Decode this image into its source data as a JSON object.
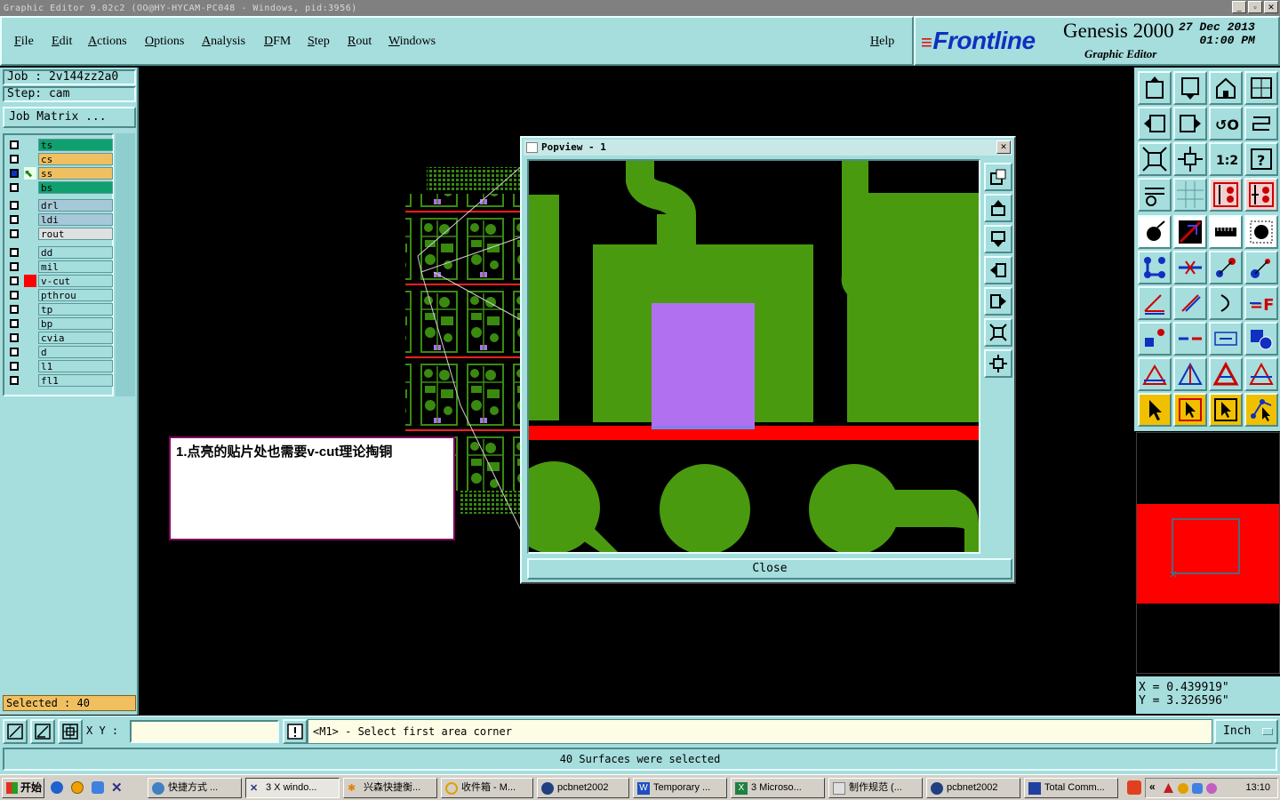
{
  "window": {
    "title": "Graphic Editor 9.02c2  (OO@HY-HYCAM-PC048 - Windows, pid:3956)"
  },
  "menu": {
    "items": [
      "File",
      "Edit",
      "Actions",
      "Options",
      "Analysis",
      "DFM",
      "Step",
      "Rout",
      "Windows"
    ],
    "help": "Help"
  },
  "brand": {
    "logo": "Frontline",
    "product": "Genesis 2000",
    "subtitle": "Graphic Editor",
    "date": "27 Dec 2013",
    "time": "01:00 PM"
  },
  "job": {
    "job_label": "Job : 2v144zz2a0",
    "step_label": "Step: cam",
    "matrix_button": "Job Matrix ..."
  },
  "layers": [
    {
      "name": "ts",
      "color": "#10a070"
    },
    {
      "name": "cs",
      "color": "#f0c060"
    },
    {
      "name": "ss",
      "color": "#f0c060",
      "active": true
    },
    {
      "name": "bs",
      "color": "#10a070"
    },
    {
      "name": "drl",
      "color": "#a6c8d8"
    },
    {
      "name": "ldi",
      "color": "#a6c8d8"
    },
    {
      "name": "rout",
      "color": "#e0e0e0"
    },
    {
      "name": "dd",
      "color": "#a6dddd"
    },
    {
      "name": "mil",
      "color": "#a6dddd"
    },
    {
      "name": "v-cut",
      "color": "#a6dddd",
      "marker": "#ff0000"
    },
    {
      "name": "pthrou",
      "color": "#a6dddd"
    },
    {
      "name": "tp",
      "color": "#a6dddd"
    },
    {
      "name": "bp",
      "color": "#a6dddd"
    },
    {
      "name": "cvia",
      "color": "#a6dddd"
    },
    {
      "name": "d",
      "color": "#a6dddd"
    },
    {
      "name": "l1",
      "color": "#a6dddd"
    },
    {
      "name": "fl1",
      "color": "#a6dddd"
    }
  ],
  "selected": "Selected : 40",
  "note": {
    "text": "1.点亮的贴片处也需要v-cut理论掏铜"
  },
  "popview": {
    "title": "Popview - 1",
    "close_label": "Close"
  },
  "coords": {
    "x": "X = 0.439919\"",
    "y": "Y = 3.326596\""
  },
  "command": {
    "xy_label": "X Y :",
    "xy_value": "",
    "prompt": "<M1> - Select first area corner",
    "units": "Inch"
  },
  "status": "40 Surfaces were selected",
  "taskbar": {
    "start": "开始",
    "items": [
      {
        "label": "快捷方式 ..."
      },
      {
        "label": "3 X windo..."
      },
      {
        "label": "兴森快捷衡..."
      },
      {
        "label": "收件箱 - M..."
      },
      {
        "label": "pcbnet2002"
      },
      {
        "label": "Temporary ..."
      },
      {
        "label": "3 Microso..."
      },
      {
        "label": "制作规范 (..."
      },
      {
        "label": "pcbnet2002"
      },
      {
        "label": "Total Comm..."
      }
    ],
    "clock": "13:10"
  },
  "colors": {
    "panel": "#a6dddd",
    "copper": "#4a9a10",
    "vcut": "#ff0000",
    "selected_pad": "#b070f0"
  }
}
